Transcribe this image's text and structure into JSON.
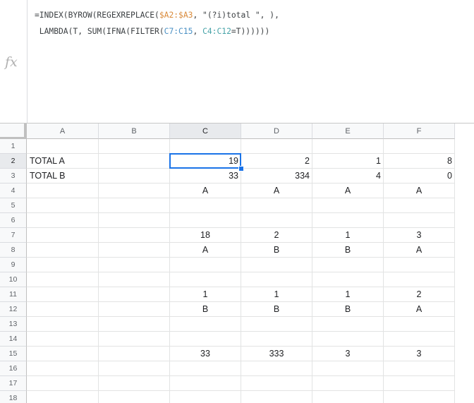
{
  "formula_bar": {
    "fx_label": "fx",
    "line1": {
      "p1": "=INDEX(BYROW(REGEXREPLACE(",
      "r1": "$A2:$A3",
      "p2": ", \"(?i)total \", ),"
    },
    "line2": {
      "p1": " LAMBDA(T, SUM(IFNA(FILTER(",
      "r1": "C7:C15",
      "p2": ", ",
      "r2": "C4:C12",
      "p3": "=T))))))"
    },
    "ref_colors": {
      "a_range": "#d98a3a",
      "c_range": "#4a90c4",
      "d_range": "#47a3a8"
    }
  },
  "grid": {
    "columns": [
      "A",
      "B",
      "C",
      "D",
      "E",
      "F"
    ],
    "rows": [
      "1",
      "2",
      "3",
      "4",
      "5",
      "6",
      "7",
      "8",
      "9",
      "10",
      "11",
      "12",
      "13",
      "14",
      "15",
      "16",
      "17",
      "18"
    ],
    "selected_cell": "C2",
    "selection_color": "#1a73e8",
    "cells": [
      {
        "row": 2,
        "col": "A",
        "value": "TOTAL A",
        "align": "left"
      },
      {
        "row": 2,
        "col": "C",
        "value": "19",
        "align": "right"
      },
      {
        "row": 2,
        "col": "D",
        "value": "2",
        "align": "right"
      },
      {
        "row": 2,
        "col": "E",
        "value": "1",
        "align": "right"
      },
      {
        "row": 2,
        "col": "F",
        "value": "8",
        "align": "right"
      },
      {
        "row": 3,
        "col": "A",
        "value": "TOTAL B",
        "align": "left"
      },
      {
        "row": 3,
        "col": "C",
        "value": "33",
        "align": "right"
      },
      {
        "row": 3,
        "col": "D",
        "value": "334",
        "align": "right"
      },
      {
        "row": 3,
        "col": "E",
        "value": "4",
        "align": "right"
      },
      {
        "row": 3,
        "col": "F",
        "value": "0",
        "align": "right"
      },
      {
        "row": 4,
        "col": "C",
        "value": "A",
        "align": "center"
      },
      {
        "row": 4,
        "col": "D",
        "value": "A",
        "align": "center"
      },
      {
        "row": 4,
        "col": "E",
        "value": "A",
        "align": "center"
      },
      {
        "row": 4,
        "col": "F",
        "value": "A",
        "align": "center"
      },
      {
        "row": 7,
        "col": "C",
        "value": "18",
        "align": "center"
      },
      {
        "row": 7,
        "col": "D",
        "value": "2",
        "align": "center"
      },
      {
        "row": 7,
        "col": "E",
        "value": "1",
        "align": "center"
      },
      {
        "row": 7,
        "col": "F",
        "value": "3",
        "align": "center"
      },
      {
        "row": 8,
        "col": "C",
        "value": "A",
        "align": "center"
      },
      {
        "row": 8,
        "col": "D",
        "value": "B",
        "align": "center"
      },
      {
        "row": 8,
        "col": "E",
        "value": "B",
        "align": "center"
      },
      {
        "row": 8,
        "col": "F",
        "value": "A",
        "align": "center"
      },
      {
        "row": 11,
        "col": "C",
        "value": "1",
        "align": "center"
      },
      {
        "row": 11,
        "col": "D",
        "value": "1",
        "align": "center"
      },
      {
        "row": 11,
        "col": "E",
        "value": "1",
        "align": "center"
      },
      {
        "row": 11,
        "col": "F",
        "value": "2",
        "align": "center"
      },
      {
        "row": 12,
        "col": "C",
        "value": "B",
        "align": "center"
      },
      {
        "row": 12,
        "col": "D",
        "value": "B",
        "align": "center"
      },
      {
        "row": 12,
        "col": "E",
        "value": "B",
        "align": "center"
      },
      {
        "row": 12,
        "col": "F",
        "value": "A",
        "align": "center"
      },
      {
        "row": 15,
        "col": "C",
        "value": "33",
        "align": "center"
      },
      {
        "row": 15,
        "col": "D",
        "value": "333",
        "align": "center"
      },
      {
        "row": 15,
        "col": "E",
        "value": "3",
        "align": "center"
      },
      {
        "row": 15,
        "col": "F",
        "value": "3",
        "align": "center"
      }
    ]
  }
}
